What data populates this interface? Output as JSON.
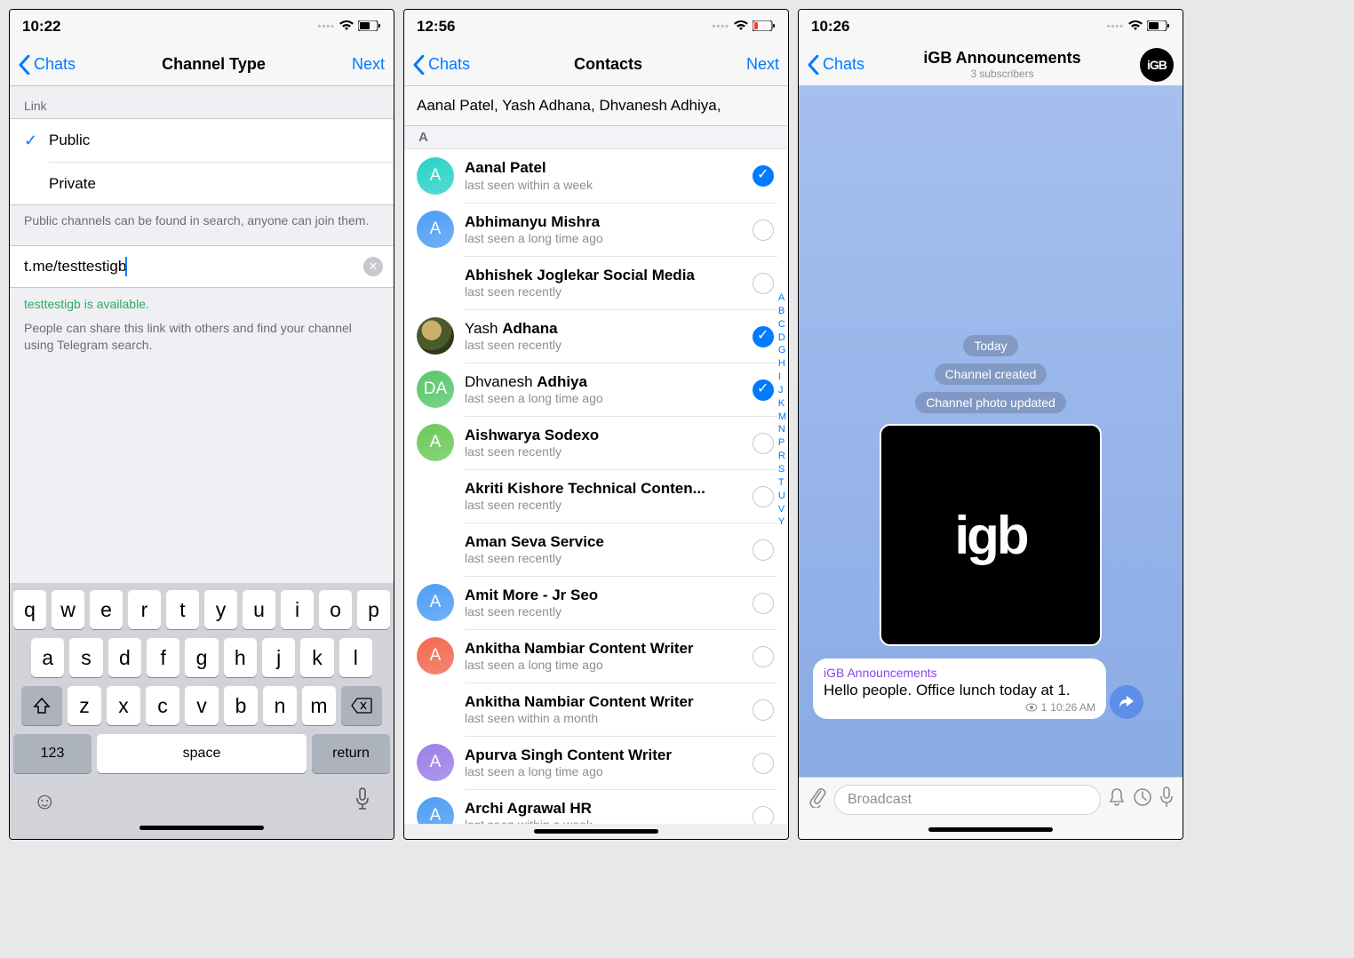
{
  "screen1": {
    "time": "10:22",
    "back": "Chats",
    "title": "Channel Type",
    "next": "Next",
    "link_header": "Link",
    "opt_public": "Public",
    "opt_private": "Private",
    "public_note": "Public channels can be found in search, anyone can join them.",
    "link_prefix": "t.me/",
    "link_value": "testtestigb",
    "available": "testtestigb is available.",
    "share_note": "People can share this link with others and find your channel using Telegram search.",
    "keys_r1": [
      "q",
      "w",
      "e",
      "r",
      "t",
      "y",
      "u",
      "i",
      "o",
      "p"
    ],
    "keys_r2": [
      "a",
      "s",
      "d",
      "f",
      "g",
      "h",
      "j",
      "k",
      "l"
    ],
    "keys_r3": [
      "z",
      "x",
      "c",
      "v",
      "b",
      "n",
      "m"
    ],
    "key_123": "123",
    "key_space": "space",
    "key_return": "return"
  },
  "screen2": {
    "time": "12:56",
    "back": "Chats",
    "title": "Contacts",
    "next": "Next",
    "selected": "Aanal Patel,   Yash Adhana,   Dhvanesh Adhiya,",
    "letter": "A",
    "index": [
      "A",
      "B",
      "C",
      "D",
      "G",
      "H",
      "I",
      "J",
      "K",
      "M",
      "N",
      "P",
      "R",
      "S",
      "T",
      "U",
      "V",
      "Y"
    ],
    "contacts": [
      {
        "name_light": "",
        "name_bold": "Aanal Patel",
        "status": "last seen within a week",
        "avatar": "A",
        "color": "#29d3c6",
        "checked": true,
        "img": false
      },
      {
        "name_light": "",
        "name_bold": "Abhimanyu Mishra",
        "status": "last seen a long time ago",
        "avatar": "A",
        "color": "#4e9df5",
        "checked": false,
        "img": false
      },
      {
        "name_light": "",
        "name_bold": "Abhishek Joglekar Social Media",
        "status": "last seen recently",
        "avatar": "",
        "color": "",
        "checked": false,
        "img": false
      },
      {
        "name_light": "Yash ",
        "name_bold": "Adhana",
        "status": "last seen recently",
        "avatar": "",
        "color": "",
        "checked": true,
        "img": true
      },
      {
        "name_light": "Dhvanesh ",
        "name_bold": "Adhiya",
        "status": "last seen a long time ago",
        "avatar": "DA",
        "color": "#58c86b",
        "checked": true,
        "img": false
      },
      {
        "name_light": "",
        "name_bold": "Aishwarya Sodexo",
        "status": "last seen recently",
        "avatar": "A",
        "color": "#6cc95a",
        "checked": false,
        "img": false
      },
      {
        "name_light": "",
        "name_bold": "Akriti Kishore Technical Conten...",
        "status": "last seen recently",
        "avatar": "",
        "color": "",
        "checked": false,
        "img": false
      },
      {
        "name_light": "",
        "name_bold": "Aman Seva Service",
        "status": "last seen recently",
        "avatar": "",
        "color": "",
        "checked": false,
        "img": false
      },
      {
        "name_light": "",
        "name_bold": "Amit More - Jr Seo",
        "status": "last seen recently",
        "avatar": "A",
        "color": "#4e9df5",
        "checked": false,
        "img": false
      },
      {
        "name_light": "",
        "name_bold": "Ankitha Nambiar Content Writer",
        "status": "last seen a long time ago",
        "avatar": "A",
        "color": "#f2694f",
        "checked": false,
        "img": false
      },
      {
        "name_light": "",
        "name_bold": "Ankitha Nambiar Content Writer",
        "status": "last seen within a month",
        "avatar": "",
        "color": "",
        "checked": false,
        "img": false
      },
      {
        "name_light": "",
        "name_bold": "Apurva Singh Content Writer",
        "status": "last seen a long time ago",
        "avatar": "A",
        "color": "#9b7fe8",
        "checked": false,
        "img": false
      },
      {
        "name_light": "",
        "name_bold": "Archi Agrawal HR",
        "status": "last seen within a week",
        "avatar": "A",
        "color": "#4e9df5",
        "checked": false,
        "img": false
      }
    ]
  },
  "screen3": {
    "time": "10:26",
    "back": "Chats",
    "title": "iGB Announcements",
    "subtitle": "3 subscribers",
    "chip_today": "Today",
    "chip_created": "Channel created",
    "chip_photo": "Channel photo updated",
    "logo": "iGB",
    "msg_author": "iGB Announcements",
    "msg_text": "Hello people. Office lunch today at 1.",
    "msg_views": "1",
    "msg_time": "10:26 AM",
    "input_placeholder": "Broadcast"
  }
}
